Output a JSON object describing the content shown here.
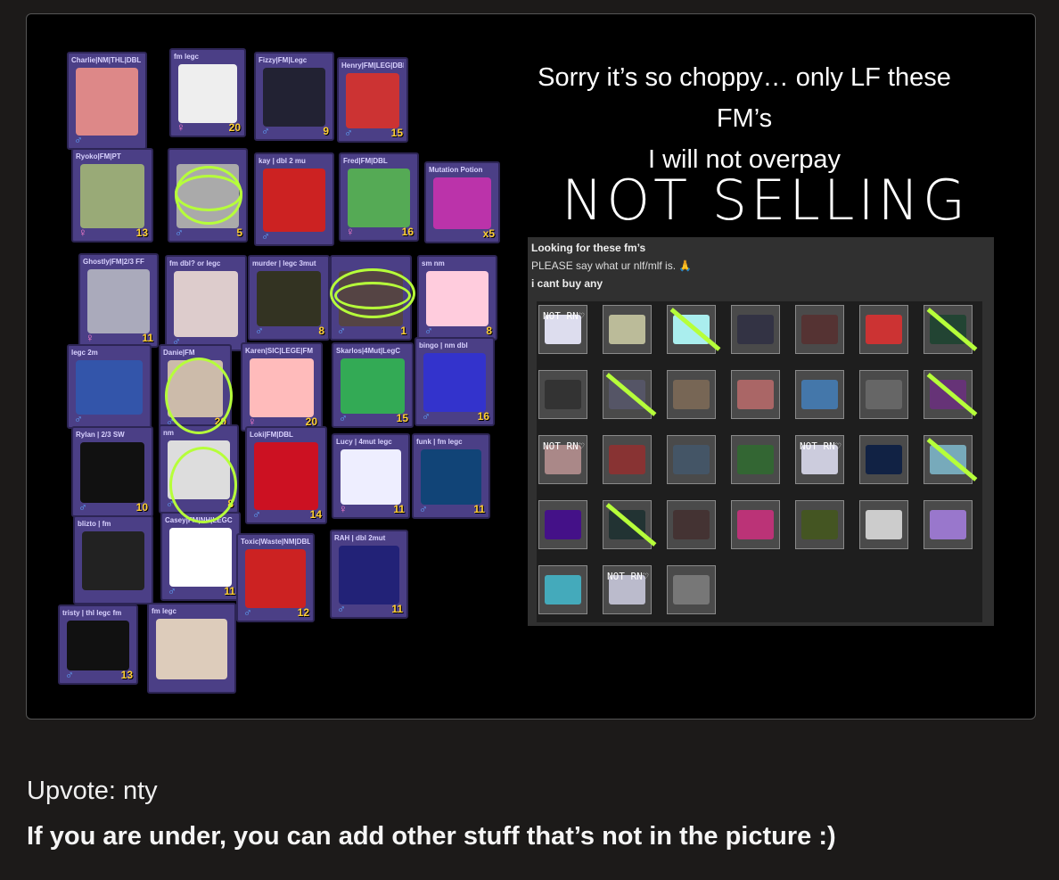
{
  "post": {
    "headline": [
      "Sorry it’s so choppy… only LF these",
      "FM’s",
      "I will not overpay"
    ],
    "not_selling": "NOT SELLING",
    "caption_line1": "Upvote: nty",
    "caption_line2": "If you are under, you can add other stuff that’s not in the picture :)"
  },
  "panel": {
    "title": "Looking for these fm’s",
    "subtitle": "PLEASE say what ur nlf/mlf is. 🙏",
    "note": "i cant buy any"
  },
  "inventory": [
    {
      "name": "Charlie|NM|THL|DBL",
      "count": "",
      "sex": "m"
    },
    {
      "name": "fm legc",
      "count": "20",
      "sex": "f"
    },
    {
      "name": "Fizzy|FM|Legc",
      "count": "9",
      "sex": "m"
    },
    {
      "name": "Henry|FM|LEG|DBL",
      "count": "15",
      "sex": "m"
    },
    {
      "name": "Ryoko|FM|PT",
      "count": "13",
      "sex": "f"
    },
    {
      "name": "",
      "count": "5",
      "sex": "m"
    },
    {
      "name": "kay | dbl 2 mu",
      "count": "",
      "sex": "m"
    },
    {
      "name": "Fred|FM|DBL",
      "count": "16",
      "sex": "f"
    },
    {
      "name": "Mutation Potion",
      "count": "x5",
      "sex": ""
    },
    {
      "name": "Ghostly|FM|2/3 FF",
      "count": "11",
      "sex": "f"
    },
    {
      "name": "fm dbl? or legc",
      "count": "",
      "sex": "m"
    },
    {
      "name": "murder | legc 3mut",
      "count": "8",
      "sex": "m"
    },
    {
      "name": "",
      "count": "1",
      "sex": "m"
    },
    {
      "name": "sm nm",
      "count": "8",
      "sex": "m"
    },
    {
      "name": "legc 2m",
      "count": "",
      "sex": "m"
    },
    {
      "name": "Danie|FM",
      "count": "20",
      "sex": "m"
    },
    {
      "name": "Karen|SIC|LEGE|FM",
      "count": "20",
      "sex": "f"
    },
    {
      "name": "Skarlos|4Mut|LegC",
      "count": "15",
      "sex": "m"
    },
    {
      "name": "bingo | nm dbl",
      "count": "16",
      "sex": "m"
    },
    {
      "name": "Rylan | 2/3 SW",
      "count": "10",
      "sex": "m"
    },
    {
      "name": "nm",
      "count": "8",
      "sex": "m"
    },
    {
      "name": "Loki|FM|DBL",
      "count": "14",
      "sex": "m"
    },
    {
      "name": "Lucy | 4mut legc",
      "count": "11",
      "sex": "f"
    },
    {
      "name": "funk | fm legc",
      "count": "11",
      "sex": "m"
    },
    {
      "name": "blizto | fm",
      "count": "",
      "sex": ""
    },
    {
      "name": "Casey|FM|NH|LEGC",
      "count": "11",
      "sex": "m"
    },
    {
      "name": "Toxic|Waste|NM|DBL",
      "count": "12",
      "sex": "m"
    },
    {
      "name": "RAH | dbl 2mut",
      "count": "11",
      "sex": "m"
    },
    {
      "name": "tristy | thl legc fm",
      "count": "13",
      "sex": "m"
    },
    {
      "name": "fm legc",
      "count": "",
      "sex": ""
    }
  ],
  "wanted_tags": {
    "not_rn": "NOT RN♡"
  },
  "colors": {
    "tile": "#4b3f86",
    "scribble": "#b6ff3a",
    "count": "#ffcf33"
  }
}
